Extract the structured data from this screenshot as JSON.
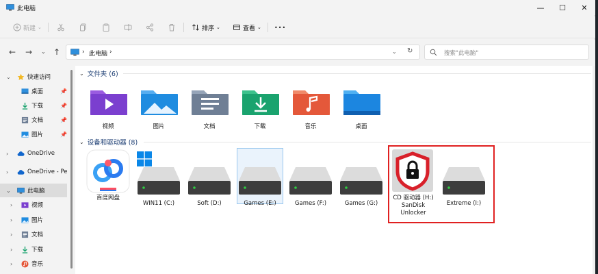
{
  "window": {
    "title": "此电脑",
    "minimize_label": "—",
    "maximize_label": "☐",
    "close_label": "✕"
  },
  "toolbar": {
    "new_label": "新建",
    "sort_label": "排序",
    "view_label": "查看",
    "more_label": "•••"
  },
  "address": {
    "crumb_pc": "此电脑",
    "crumb_sep": "›",
    "trailing_sep": "›",
    "search_placeholder": "搜索\"此电脑\""
  },
  "sidebar": {
    "items": [
      {
        "label": "快速访问",
        "icon": "star-icon"
      },
      {
        "label": "桌面",
        "icon": "desktop-icon"
      },
      {
        "label": "下载",
        "icon": "download-icon"
      },
      {
        "label": "文档",
        "icon": "document-icon"
      },
      {
        "label": "图片",
        "icon": "picture-icon"
      },
      {
        "label": "OneDrive",
        "icon": "cloud-icon"
      },
      {
        "label": "OneDrive - Pers",
        "icon": "cloud-icon"
      },
      {
        "label": "此电脑",
        "icon": "pc-icon"
      },
      {
        "label": "视频",
        "icon": "video-icon"
      },
      {
        "label": "图片",
        "icon": "picture-icon"
      },
      {
        "label": "文档",
        "icon": "document-icon"
      },
      {
        "label": "下载",
        "icon": "download-icon"
      },
      {
        "label": "音乐",
        "icon": "music-icon"
      }
    ]
  },
  "groups": {
    "folders": {
      "title": "文件夹 (6)",
      "items": [
        {
          "label": "视频",
          "color": "#7b3fcf"
        },
        {
          "label": "图片",
          "color": "#1f8ce0"
        },
        {
          "label": "文档",
          "color": "#6f7f95"
        },
        {
          "label": "下载",
          "color": "#1aa36e"
        },
        {
          "label": "音乐",
          "color": "#e4583a"
        },
        {
          "label": "桌面",
          "color": "#1c86e0"
        }
      ]
    },
    "devices": {
      "title": "设备和驱动器 (8)",
      "items": [
        {
          "label": "百度网盘"
        },
        {
          "label": "WIN11 (C:)"
        },
        {
          "label": "Soft (D:)"
        },
        {
          "label": "Games (E:)"
        },
        {
          "label": "Games (F:)"
        },
        {
          "label": "Games (G:)"
        },
        {
          "label": "CD 驱动器 (H:)\nSanDisk\nUnlocker"
        },
        {
          "label": "Extreme (I:)"
        }
      ]
    }
  },
  "colors": {
    "highlight_border": "#e02020",
    "group_title": "#1e3f74",
    "drive_led": "#2ecc40"
  }
}
